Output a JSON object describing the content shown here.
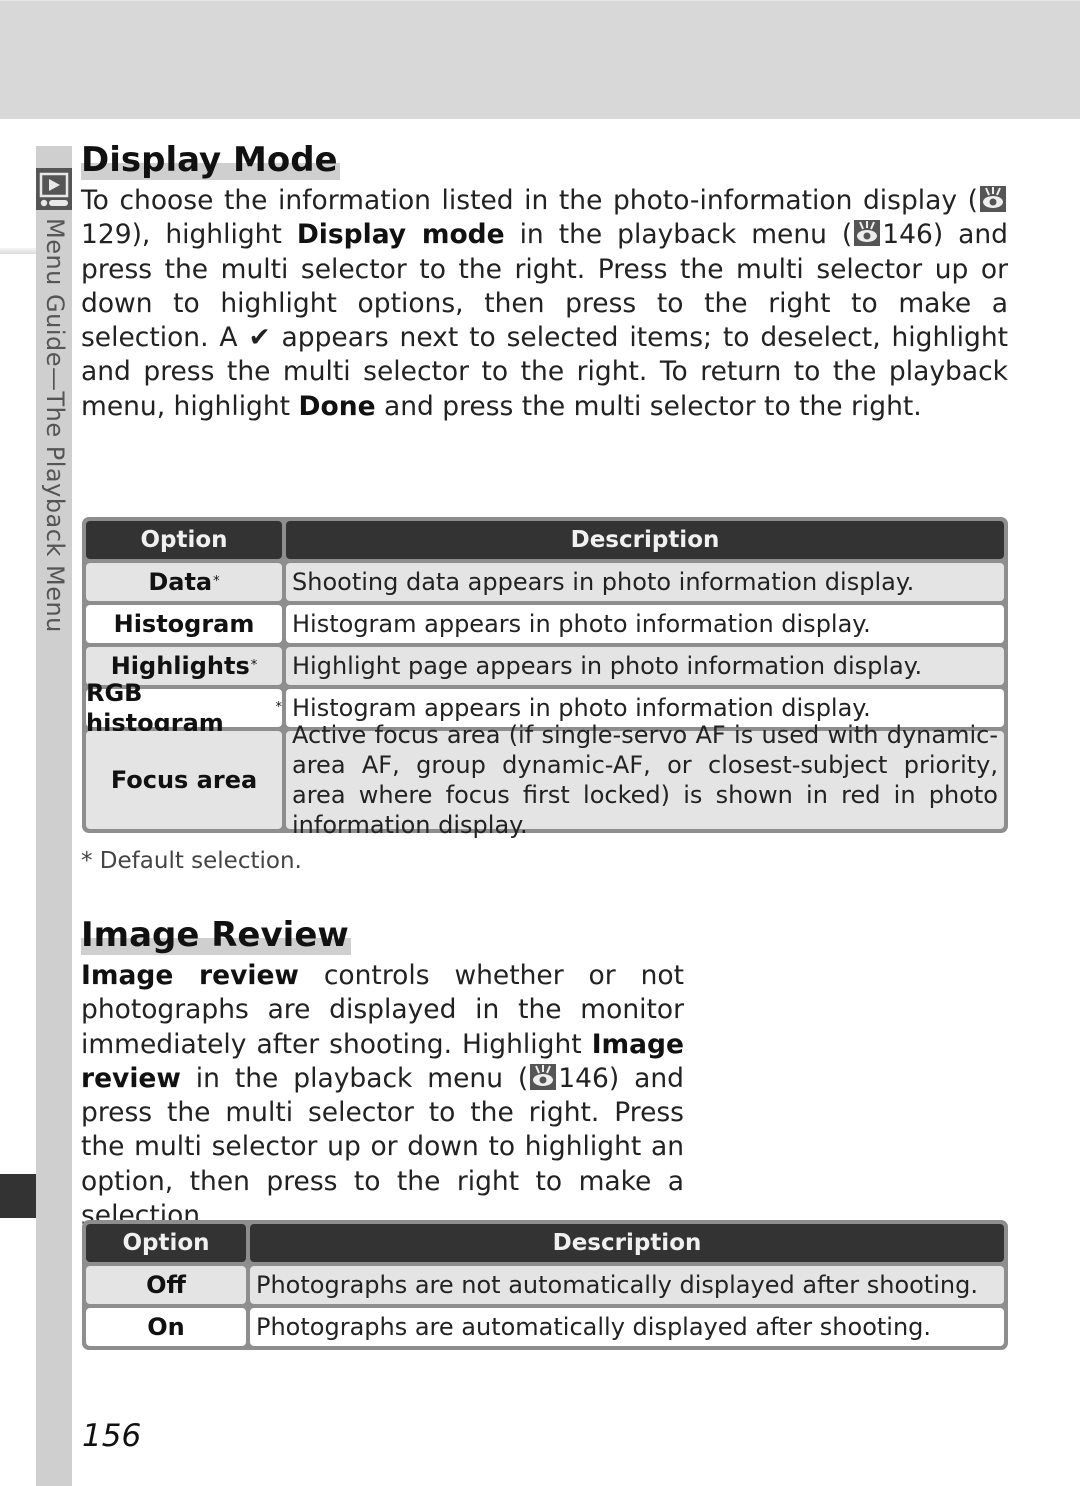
{
  "side_tab": {
    "label_prefix": "Menu Guide",
    "label_dash": "—",
    "label_suffix": "The Playback Menu",
    "icon": "playback-icon"
  },
  "section1": {
    "title": "Display Mode",
    "para": {
      "t1": "To choose the information listed in the photo-information display (",
      "ref1": "129",
      "t2": "), highlight ",
      "b1": "Display mode",
      "t3": " in the playback menu (",
      "ref2": "146",
      "t4": ") and press the multi selector to the right.  Press the multi selector up or down to highlight options, then press to the right to make a selection.  A ",
      "check": "✔",
      "t5": " appears next to selected items; to deselect, highlight and press the multi selector to the right.  To return to the playback menu, highlight ",
      "b2": "Done",
      "t6": " and press the multi selector to the right."
    },
    "table": {
      "headers": [
        "Option",
        "Description"
      ],
      "rows": [
        {
          "option": "Data",
          "default": "*",
          "description": "Shooting data appears in photo information display."
        },
        {
          "option": "Histogram",
          "default": "",
          "description": "Histogram appears in photo information display."
        },
        {
          "option": "Highlights",
          "default": "*",
          "description": "Highlight page appears in photo information display."
        },
        {
          "option": "RGB histogram",
          "default": "*",
          "description": "Histogram appears in photo information display."
        },
        {
          "option": "Focus area",
          "default": "",
          "description": "Active focus area (if single-servo AF is used with dynamic-area AF, group dynamic-AF, or closest-subject priority, area where focus first locked) is shown in red in photo information display."
        }
      ]
    },
    "footnote": "* Default selection."
  },
  "section2": {
    "title": "Image Review",
    "para": {
      "b1": "Image review",
      "t1": " controls whether or not photographs are displayed in the monitor immediately after shooting.  Highlight ",
      "b2": "Image review",
      "t2": " in the playback menu (",
      "ref1": "146",
      "t3": ") and press the multi selector to the right.  Press the multi selector up or down to highlight an option, then press to the right to make a selection."
    },
    "table": {
      "headers": [
        "Option",
        "Description"
      ],
      "rows": [
        {
          "option": "Off",
          "description": "Photographs are not automatically displayed after shooting."
        },
        {
          "option": "On",
          "description": "Photographs are automatically displayed after shooting."
        }
      ]
    }
  },
  "page_number": "156",
  "icons": {
    "reference": "eye-reference-icon",
    "check": "checkmark-icon"
  }
}
